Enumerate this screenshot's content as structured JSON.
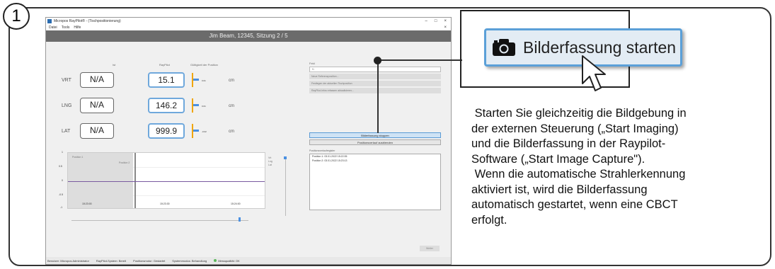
{
  "step_number": "1",
  "app": {
    "window_title": "Micropos RayPilot® - (Tischpositionierung)",
    "window_controls": [
      "–",
      "□",
      "×"
    ],
    "menu": [
      "Datei",
      "Tools",
      "Hilfe"
    ],
    "menu_close": "×",
    "session": "Jim Beam, 12345, Sitzung 2 / 5",
    "columns": {
      "ist": "Ist",
      "raypilot": "RayPilot",
      "validity": "Gültigkeit der Position"
    },
    "axes": [
      {
        "label": "VRT",
        "ist": "N/A",
        "value": "15.1",
        "offset": "0.01",
        "unit": "cm"
      },
      {
        "label": "LNG",
        "ist": "N/A",
        "value": "146.2",
        "offset": "0.01",
        "unit": "cm"
      },
      {
        "label": "LAT",
        "ist": "N/A",
        "value": "999.9",
        "offset": "-0.02",
        "unit": "cm"
      }
    ],
    "mini_scale": {
      "top": "0.3",
      "mid": "0.0",
      "bottom": "-0.3"
    },
    "plot": {
      "yticks": [
        "1",
        "0.5",
        "0",
        "-0.5",
        "-1"
      ],
      "xticks": [
        "15:23:00",
        "15:23:30",
        "15:24:00"
      ],
      "legend": [
        "Vrt",
        "Lng",
        "Lat"
      ],
      "labels": [
        "Position 1",
        "Position 2"
      ]
    },
    "field_label": "Feld",
    "field_value": "f1",
    "disabled_actions": [
      "Neue Referenzposition...",
      "Festlegen der aktuellen Tischposition",
      "RayPilot-Infos erfassen aktualisieren..."
    ],
    "capture_button": "Bilderfassung stoppen",
    "hide_button": "Positionsverlauf ausblenden",
    "position_register_label": "Positionsverlaufregister",
    "positions": [
      "Position 1: 03.01.2022 15:22:35",
      "Position 2: 03.01.2022 15:23:13"
    ],
    "close_button": "Weiter",
    "status": [
      "Benutzer: Micropos Administrator",
      "RayPilot-System: Bereit",
      "Positionsmotor: Gestartet",
      "Systemmodus: Behandlung",
      "Messqualität: OK"
    ]
  },
  "callout": {
    "button_label": "Bilderfassung starten",
    "icon": "camera-icon",
    "description": [
      " Starten Sie gleichzeitig die Bildgebung in",
      "der externen Steuerung („Start Imaging)",
      "und die Bilderfassung in der Raypilot-",
      "Software („Start Image Capture\").",
      " Wenn die automatische Strahlerkennung",
      "aktiviert ist, wird die Bilderfassung",
      "automatisch gestartet, wenn eine CBCT",
      "erfolgt."
    ]
  },
  "colors": {
    "accent": "#5ba0d8",
    "orange": "#f0a500",
    "session_bar": "#6b6b6b"
  }
}
